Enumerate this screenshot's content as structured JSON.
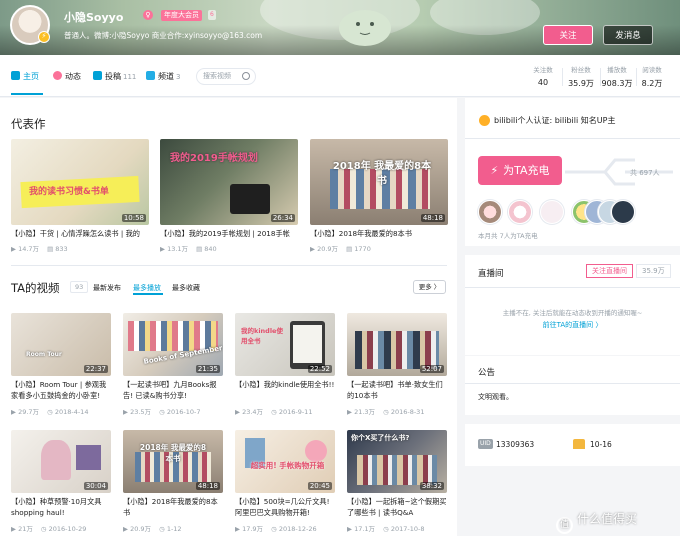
{
  "header": {
    "username": "小隐Soyyo",
    "sex_icon": "female-icon",
    "level_label": "LV6",
    "vip_label": "年度大会员",
    "badge_label": "6",
    "signature": "普通人。微博:小隐Soyyo 商业合作:xyinsoyyo@163.com",
    "follow_label": "关注",
    "message_label": "发消息"
  },
  "nav": {
    "items": [
      {
        "label": "主页",
        "count": "",
        "icon": "home-icon"
      },
      {
        "label": "动态",
        "count": "",
        "icon": "dynamic-icon"
      },
      {
        "label": "投稿",
        "count": "111",
        "icon": "upload-icon"
      },
      {
        "label": "频道",
        "count": "3",
        "icon": "channel-icon"
      }
    ],
    "search_placeholder": "搜索视频"
  },
  "stats": [
    {
      "label": "关注数",
      "value": "40"
    },
    {
      "label": "粉丝数",
      "value": "35.9万"
    },
    {
      "label": "播放数",
      "value": "908.3万"
    },
    {
      "label": "阅读数",
      "value": "8.2万"
    }
  ],
  "masterpiece": {
    "title": "代表作",
    "videos": [
      {
        "cover_text": "我的读书习惯&书单",
        "duration": "10:58",
        "title": "【小隐】干货 | 心情浮躁怎么读书 | 我的",
        "plays": "14.7万",
        "danmaku": "833"
      },
      {
        "cover_text": "我的2019手帐规划",
        "duration": "26:34",
        "title": "【小隐】我的2019手帐规划 | 2018手帐",
        "plays": "13.1万",
        "danmaku": "840"
      },
      {
        "cover_text": "2018年 我最爱的8本书",
        "duration": "48:18",
        "title": "【小隐】2018年我最爱的8本书",
        "plays": "20.9万",
        "danmaku": "1770"
      }
    ]
  },
  "videos_section": {
    "title": "TA的视频",
    "count": "93",
    "tabs": [
      "最新发布",
      "最多播放",
      "最多收藏"
    ],
    "more_label": "更多 〉",
    "videos": [
      {
        "cover_text": "Room Tour",
        "duration": "22:37",
        "title": "【小隐】Room Tour | 参观我家看多小五鼓捣金的小卧室!",
        "plays": "29.7万",
        "date": "2018-4-14"
      },
      {
        "cover_text": "Books of September",
        "duration": "21:35",
        "title": "【一起读书吧】九月Books报告! 已读&购书分享!",
        "plays": "23.5万",
        "date": "2016-10-7"
      },
      {
        "cover_text": "我的kindle使用全书",
        "duration": "22:52",
        "title": "【小隐】我的kindle使用全书!!",
        "plays": "23.4万",
        "date": "2016-9-11"
      },
      {
        "cover_text": "",
        "duration": "52:07",
        "title": "【一起读书吧】书单·致女生们的10本书",
        "plays": "21.3万",
        "date": "2016-8-31"
      },
      {
        "cover_text": "",
        "duration": "30:04",
        "title": "【小隐】种草预警·10月文具shopping haul!",
        "plays": "21万",
        "date": "2016-10-29"
      },
      {
        "cover_text": "2018年 我最爱的8本书",
        "duration": "48:18",
        "title": "【小隐】2018年我最爱的8本书",
        "plays": "20.9万",
        "date": "1-12"
      },
      {
        "cover_text": "超实用! 手帐购物开箱",
        "duration": "20:45",
        "title": "【小隐】500块=几公斤文具! 阿里巴巴文具购物开箱!",
        "plays": "17.9万",
        "date": "2018-12-26"
      },
      {
        "cover_text": "你个X买了什么书?",
        "duration": "38:32",
        "title": "【小隐】一起拆箱~这个假期买了哪些书 | 读书Q&A",
        "plays": "17.1万",
        "date": "2017-10-8"
      }
    ]
  },
  "sidebar": {
    "certification": "bilibili个人认证: bilibili 知名UP主",
    "charge_label": "为TA充电",
    "charge_total": "共 697人",
    "charge_note": "本月共 7人为TA充电",
    "live": {
      "title": "直播间",
      "follow_label": "关注直播间",
      "followers": "35.9万",
      "message": "主播不在, 关注后就能在动态收到开播的通知喔~",
      "link": "前往TA的直播间 〉"
    },
    "notice": {
      "title": "公告",
      "text": "文明观看。"
    },
    "info": {
      "uid_label": "UID",
      "uid": "13309363",
      "birthday": "10-16"
    }
  },
  "watermark": {
    "text": "什么值得买",
    "icon_char": "值"
  }
}
